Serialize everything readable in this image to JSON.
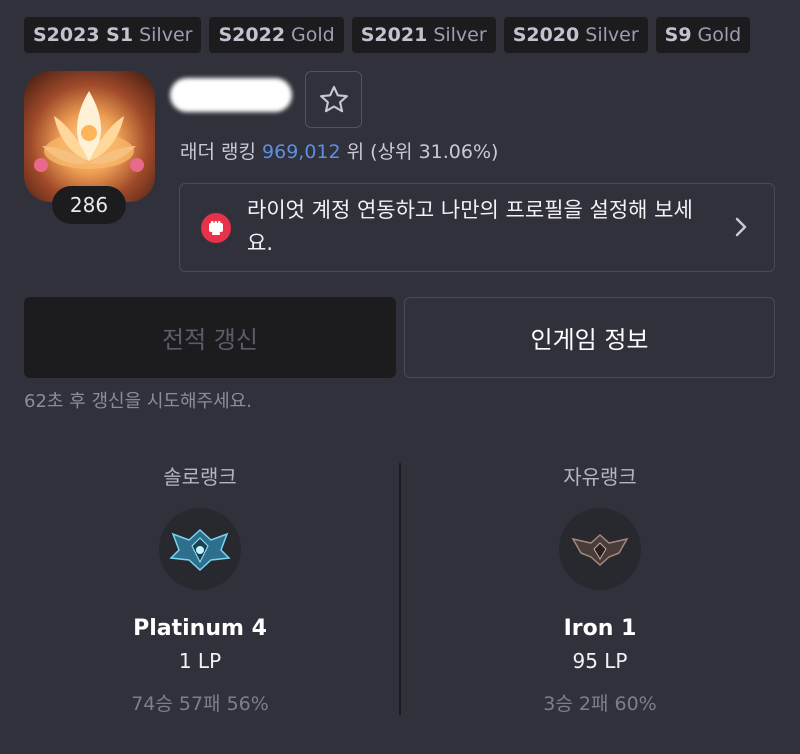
{
  "seasons": [
    {
      "season": "S2023 S1",
      "tier": "Silver"
    },
    {
      "season": "S2022",
      "tier": "Gold"
    },
    {
      "season": "S2021",
      "tier": "Silver"
    },
    {
      "season": "S2020",
      "tier": "Silver"
    },
    {
      "season": "S9",
      "tier": "Gold"
    }
  ],
  "profile": {
    "level": "286",
    "ladder_label": "래더 랭킹",
    "ladder_rank": "969,012",
    "ladder_suffix": "위 (상위 31.06%)"
  },
  "riot_banner": {
    "text": "라이엇 계정 연동하고 나만의 프로필을 설정해 보세요."
  },
  "actions": {
    "renew_label": "전적 갱신",
    "ingame_label": "인게임 정보",
    "renew_hint": "62초 후 갱신을 시도해주세요."
  },
  "ranks": {
    "solo": {
      "queue": "솔로랭크",
      "tier": "Platinum 4",
      "lp": "1 LP",
      "record": "74승 57패 56%"
    },
    "flex": {
      "queue": "자유랭크",
      "tier": "Iron 1",
      "lp": "95 LP",
      "record": "3승 2패 60%"
    }
  },
  "colors": {
    "background": "#31313c",
    "tag_background": "#1c1c1f",
    "ladder_rank": "#5e8fe0",
    "riot_red": "#e8314a"
  },
  "icons": {
    "favorite": "star-outline-icon",
    "riot": "riot-fist-icon",
    "banner_arrow": "chevron-right-icon"
  }
}
